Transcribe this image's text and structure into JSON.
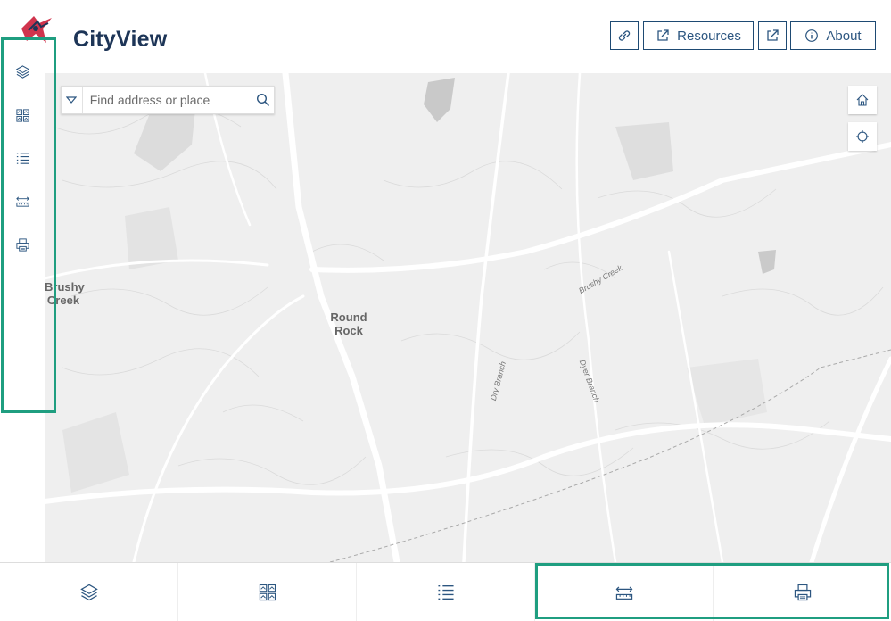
{
  "app": {
    "title": "CityView"
  },
  "header": {
    "link_button_icon": "link-icon",
    "resources_label": "Resources",
    "external_icon": "external-link-icon",
    "about_label": "About"
  },
  "search": {
    "placeholder": "Find address or place"
  },
  "map": {
    "labels": [
      {
        "text": "Brushy\nCreek"
      },
      {
        "text": "Round\nRock"
      }
    ],
    "road_labels": [
      "Brushy Creek",
      "Dry Branch",
      "Dyer Branch"
    ]
  },
  "left_toolbar": [
    "layers-icon",
    "basemap-gallery-icon",
    "legend-icon",
    "measure-icon",
    "print-icon"
  ],
  "bottom_toolbar": [
    "layers-icon",
    "basemap-gallery-icon",
    "legend-icon",
    "measure-icon",
    "print-icon"
  ],
  "colors": {
    "accent": "#1f9e80",
    "brand": "#1d3557",
    "map_bg": "#efefef"
  }
}
